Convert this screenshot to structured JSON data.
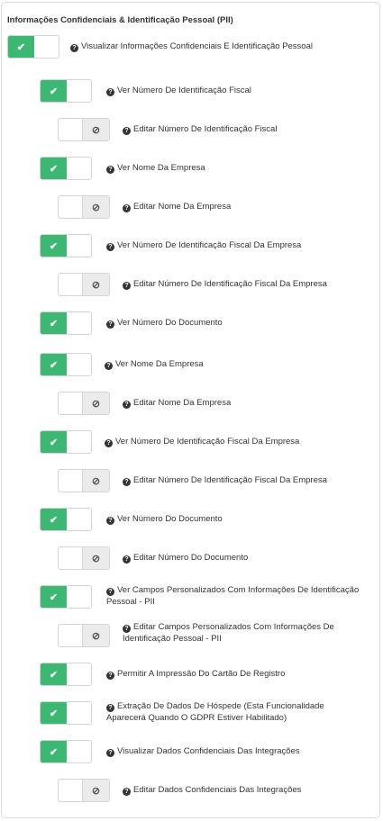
{
  "section_title": "Informações Confidenciais & Identificação Pessoal (PII)",
  "icons": {
    "check": "✔",
    "ban": "⊘",
    "help": "?"
  },
  "colors": {
    "on": "#3cb873",
    "off": "#ebebeb"
  },
  "permissions": [
    {
      "label": "Visualizar Informações Confidenciais E Identificação Pessoal",
      "on": true
    },
    {
      "label": "Ver Número De Identificação Fiscal",
      "on": true
    },
    {
      "label": "Editar Número De Identificação Fiscal",
      "on": false
    },
    {
      "label": "Ver Nome Da Empresa",
      "on": true
    },
    {
      "label": "Editar Nome Da Empresa",
      "on": false
    },
    {
      "label": "Ver Número De Identificação Fiscal Da Empresa",
      "on": true
    },
    {
      "label": "Editar Número De Identificação Fiscal Da Empresa",
      "on": false
    },
    {
      "label": "Ver Número Do Documento",
      "on": true
    },
    {
      "label": "Ver Nome Da Empresa",
      "on": true
    },
    {
      "label": "Editar Nome Da Empresa",
      "on": false
    },
    {
      "label": "Ver Número De Identificação Fiscal Da Empresa",
      "on": true
    },
    {
      "label": "Editar Número De Identificação Fiscal Da Empresa",
      "on": false
    },
    {
      "label": "Ver Número Do Documento",
      "on": true
    },
    {
      "label": "Editar Número Do Documento",
      "on": false
    },
    {
      "label": "Ver Campos Personalizados Com Informações De Identificação Pessoal - PII",
      "on": true
    },
    {
      "label": "Editar Campos Personalizados Com Informações De Identificação Pessoal - PII",
      "on": false
    },
    {
      "label": "Permitir A Impressão Do Cartão De Registro",
      "on": true
    },
    {
      "label": "Extração De Dados De Hóspede (Esta Funcionalidade Aparecerá Quando O GDPR Estiver Habilitado)",
      "on": true
    },
    {
      "label": "Visualizar Dados Confidenciais Das Integrações",
      "on": true
    },
    {
      "label": "Editar Dados Confidenciais Das Integrações",
      "on": false
    }
  ]
}
